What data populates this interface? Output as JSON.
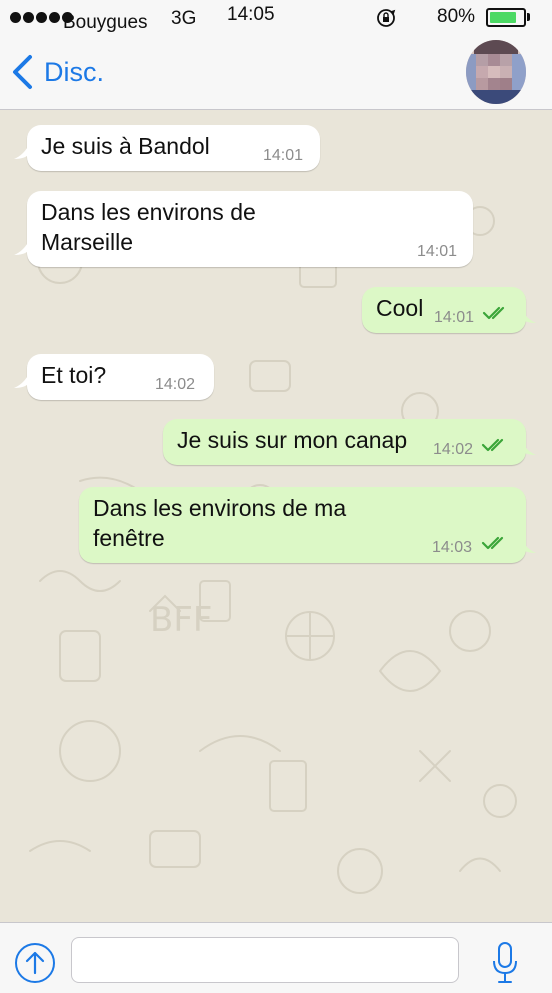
{
  "status_bar": {
    "carrier": "Bouygues",
    "network": "3G",
    "time": "14:05",
    "battery_percent_label": "80%",
    "battery_level": 0.8
  },
  "nav": {
    "back_label": "Disc."
  },
  "messages": [
    {
      "direction": "in",
      "lines": [
        "Je suis à Bandol"
      ],
      "time": "14:01"
    },
    {
      "direction": "in",
      "lines": [
        "Dans les environs de",
        "Marseille"
      ],
      "time": "14:01"
    },
    {
      "direction": "out",
      "lines": [
        "Cool"
      ],
      "time": "14:01",
      "status": "read"
    },
    {
      "direction": "in",
      "lines": [
        "Et toi?"
      ],
      "time": "14:02"
    },
    {
      "direction": "out",
      "lines": [
        "Je suis sur mon canap"
      ],
      "time": "14:02",
      "status": "read"
    },
    {
      "direction": "out",
      "lines": [
        "Dans les environs de ma",
        "fenêtre"
      ],
      "time": "14:03",
      "status": "read"
    }
  ],
  "input": {
    "placeholder": "",
    "value": ""
  },
  "icons": {
    "back": "chevron-left-icon",
    "share": "arrow-up-circle-icon",
    "mic": "microphone-icon",
    "read_receipt": "double-check-icon",
    "rotation_lock": "rotation-lock-icon"
  },
  "colors": {
    "accent": "#1c79e6",
    "outgoing_bubble": "#dcf8c6",
    "incoming_bubble": "#ffffff",
    "chat_background": "#e9e5d9",
    "read_ticks": "#3ba539",
    "battery": "#4cd964"
  }
}
